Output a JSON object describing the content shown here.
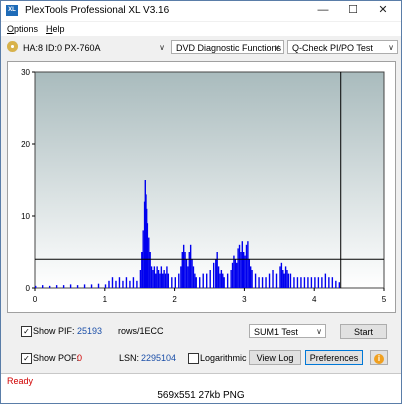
{
  "window": {
    "title": "PlexTools Professional XL V3.16",
    "app_icon": "XL",
    "minimize_glyph": "—",
    "maximize_glyph": "☐",
    "close_glyph": "✕"
  },
  "menu": {
    "options_first": "O",
    "options_rest": "ptions",
    "help_first": "H",
    "help_rest": "elp"
  },
  "toolbar": {
    "drive": "HA:8 ID:0  PX-760A",
    "function": "DVD Diagnostic Functions",
    "test": "Q-Check PI/PO Test",
    "arrow": "∨"
  },
  "chart_data": {
    "type": "bar",
    "x_ticks": [
      "0",
      "1",
      "2",
      "3",
      "4",
      "5"
    ],
    "y_ticks": [
      "30",
      "20",
      "10",
      "0"
    ],
    "xlim": [
      0,
      5
    ],
    "ylim": [
      0,
      30
    ],
    "threshold": 4,
    "end_marker_x": 4.38,
    "grid": "off",
    "colors": {
      "bars": "#0000ee",
      "background_top": "#a9bbbd",
      "background_bottom": "#ffffff",
      "marker": "#000000"
    },
    "series": [
      {
        "values": [
          [
            0.0,
            0.3
          ],
          [
            0.1,
            0.4
          ],
          [
            0.2,
            0.3
          ],
          [
            0.3,
            0.4
          ],
          [
            0.4,
            0.4
          ],
          [
            0.5,
            0.5
          ],
          [
            0.6,
            0.4
          ],
          [
            0.7,
            0.5
          ],
          [
            0.8,
            0.5
          ],
          [
            0.9,
            0.6
          ],
          [
            1.0,
            0.5
          ],
          [
            1.05,
            1.0
          ],
          [
            1.1,
            1.5
          ],
          [
            1.15,
            1.0
          ],
          [
            1.2,
            1.5
          ],
          [
            1.25,
            1.0
          ],
          [
            1.3,
            1.5
          ],
          [
            1.35,
            1.0
          ],
          [
            1.4,
            1.5
          ],
          [
            1.45,
            1.0
          ],
          [
            1.5,
            2.5
          ],
          [
            1.52,
            5.0
          ],
          [
            1.54,
            8.0
          ],
          [
            1.56,
            12.0
          ],
          [
            1.57,
            15.0
          ],
          [
            1.58,
            13.0
          ],
          [
            1.59,
            11.0
          ],
          [
            1.6,
            9.0
          ],
          [
            1.62,
            7.0
          ],
          [
            1.64,
            5.0
          ],
          [
            1.66,
            3.0
          ],
          [
            1.68,
            2.5
          ],
          [
            1.7,
            3.0
          ],
          [
            1.72,
            2.0
          ],
          [
            1.74,
            3.0
          ],
          [
            1.76,
            2.5
          ],
          [
            1.78,
            2.0
          ],
          [
            1.8,
            3.0
          ],
          [
            1.82,
            2.0
          ],
          [
            1.84,
            2.5
          ],
          [
            1.86,
            2.0
          ],
          [
            1.88,
            3.0
          ],
          [
            1.9,
            2.0
          ],
          [
            1.95,
            1.5
          ],
          [
            2.0,
            1.5
          ],
          [
            2.05,
            2.0
          ],
          [
            2.08,
            3.0
          ],
          [
            2.1,
            5.0
          ],
          [
            2.12,
            6.0
          ],
          [
            2.14,
            5.0
          ],
          [
            2.16,
            4.0
          ],
          [
            2.18,
            3.0
          ],
          [
            2.2,
            5.0
          ],
          [
            2.22,
            6.0
          ],
          [
            2.24,
            4.0
          ],
          [
            2.26,
            3.0
          ],
          [
            2.28,
            2.0
          ],
          [
            2.3,
            1.5
          ],
          [
            2.35,
            1.5
          ],
          [
            2.4,
            2.0
          ],
          [
            2.45,
            2.0
          ],
          [
            2.5,
            2.5
          ],
          [
            2.55,
            3.5
          ],
          [
            2.58,
            4.0
          ],
          [
            2.6,
            5.0
          ],
          [
            2.62,
            3.0
          ],
          [
            2.64,
            2.0
          ],
          [
            2.66,
            2.5
          ],
          [
            2.68,
            2.0
          ],
          [
            2.7,
            1.5
          ],
          [
            2.75,
            2.0
          ],
          [
            2.8,
            2.5
          ],
          [
            2.82,
            3.5
          ],
          [
            2.84,
            4.5
          ],
          [
            2.86,
            4.0
          ],
          [
            2.88,
            3.5
          ],
          [
            2.9,
            5.5
          ],
          [
            2.92,
            6.0
          ],
          [
            2.94,
            5.0
          ],
          [
            2.96,
            6.5
          ],
          [
            2.98,
            5.0
          ],
          [
            3.0,
            4.5
          ],
          [
            3.02,
            6.0
          ],
          [
            3.04,
            6.5
          ],
          [
            3.06,
            4.0
          ],
          [
            3.08,
            3.0
          ],
          [
            3.1,
            2.5
          ],
          [
            3.15,
            2.0
          ],
          [
            3.2,
            1.5
          ],
          [
            3.25,
            1.5
          ],
          [
            3.3,
            1.5
          ],
          [
            3.35,
            2.0
          ],
          [
            3.4,
            2.5
          ],
          [
            3.45,
            2.0
          ],
          [
            3.5,
            3.0
          ],
          [
            3.52,
            3.5
          ],
          [
            3.54,
            2.5
          ],
          [
            3.56,
            2.0
          ],
          [
            3.58,
            3.0
          ],
          [
            3.6,
            2.5
          ],
          [
            3.62,
            2.0
          ],
          [
            3.65,
            2.0
          ],
          [
            3.7,
            1.5
          ],
          [
            3.75,
            1.5
          ],
          [
            3.8,
            1.5
          ],
          [
            3.85,
            1.5
          ],
          [
            3.9,
            1.5
          ],
          [
            3.95,
            1.5
          ],
          [
            4.0,
            1.5
          ],
          [
            4.05,
            1.5
          ],
          [
            4.1,
            1.5
          ],
          [
            4.15,
            2.0
          ],
          [
            4.2,
            1.5
          ],
          [
            4.25,
            1.5
          ],
          [
            4.3,
            1.0
          ],
          [
            4.35,
            0.8
          ]
        ]
      }
    ]
  },
  "controls": {
    "show_pif_label": "Show PIF:",
    "pif_value": "25193",
    "rows_label": "rows/1ECC",
    "show_pof_label": "Show POF:",
    "pof_value": "0",
    "lsn_label": "LSN:",
    "lsn_value": "2295104",
    "logarithmic_label": "Logarithmic",
    "sum_select": "SUM1 Test",
    "start_button": "Start",
    "view_log_button": "View Log",
    "preferences_button": "Preferences",
    "info_glyph": "i",
    "check_glyph": "✓"
  },
  "status": {
    "text": "Ready"
  },
  "caption": "569x551  27kb  PNG"
}
